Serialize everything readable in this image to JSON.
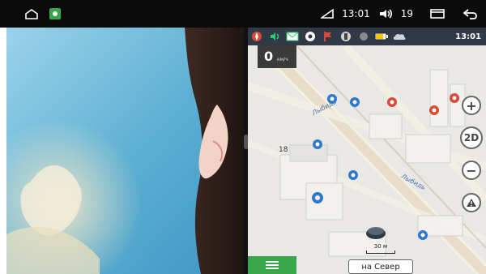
{
  "status_bar": {
    "time": "13:01",
    "volume": "19",
    "icons": [
      "home-icon",
      "app-shortcut-icon",
      "signal-icon",
      "volume-icon",
      "recent-apps-icon",
      "back-icon"
    ]
  },
  "navigation": {
    "top_bar_icons": [
      "compass-icon",
      "sound-icon",
      "message-icon",
      "gps-icon",
      "route-flag-icon",
      "traffic-icon",
      "dot-icon",
      "battery-icon",
      "cloud-icon"
    ],
    "time": "13:01",
    "speed": {
      "value": "0",
      "unit": "км/ч"
    },
    "street_labels": [
      "Лыбидь",
      "Лыбидь"
    ],
    "building_number": "18",
    "buttons": {
      "zoom_in": "+",
      "mode": "2D",
      "zoom_out": "−",
      "warning": "!"
    },
    "scale_label": "30 м",
    "north_button": "на Север",
    "menu_icon": "hamburger-menu-icon"
  },
  "colors": {
    "status_bar": "#0b0b0b",
    "nav_topbar": "#2f3a46",
    "menu_green": "#3aa64a"
  }
}
